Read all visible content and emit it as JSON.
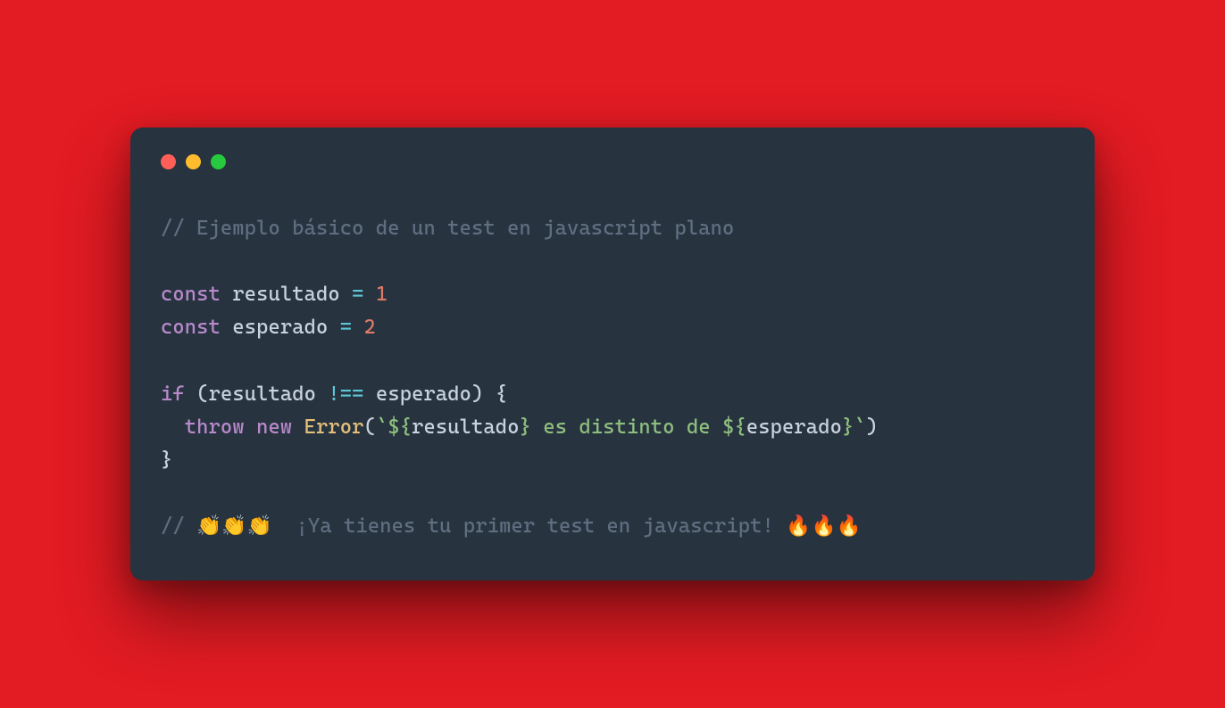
{
  "window": {
    "controls": {
      "close": "close",
      "minimize": "minimize",
      "zoom": "zoom"
    }
  },
  "code": {
    "line1_comment": "// Ejemplo básico de un test en javascript plano",
    "kw_const": "const",
    "var_resultado": "resultado",
    "var_esperado": "esperado",
    "op_assign": "=",
    "num_one": "1",
    "num_two": "2",
    "kw_if": "if",
    "paren_open": "(",
    "paren_close": ")",
    "op_neq": "!==",
    "brace_open": "{",
    "brace_close": "}",
    "kw_throw": "throw",
    "kw_new": "new",
    "cls_error": "Error",
    "backtick1": "`",
    "interp_open": "${",
    "interp_close": "}",
    "str_mid": " es distinto de ",
    "backtick2": "`",
    "line_last_comment": "// 👏👏👏  ¡Ya tienes tu primer test en javascript! 🔥🔥🔥"
  }
}
